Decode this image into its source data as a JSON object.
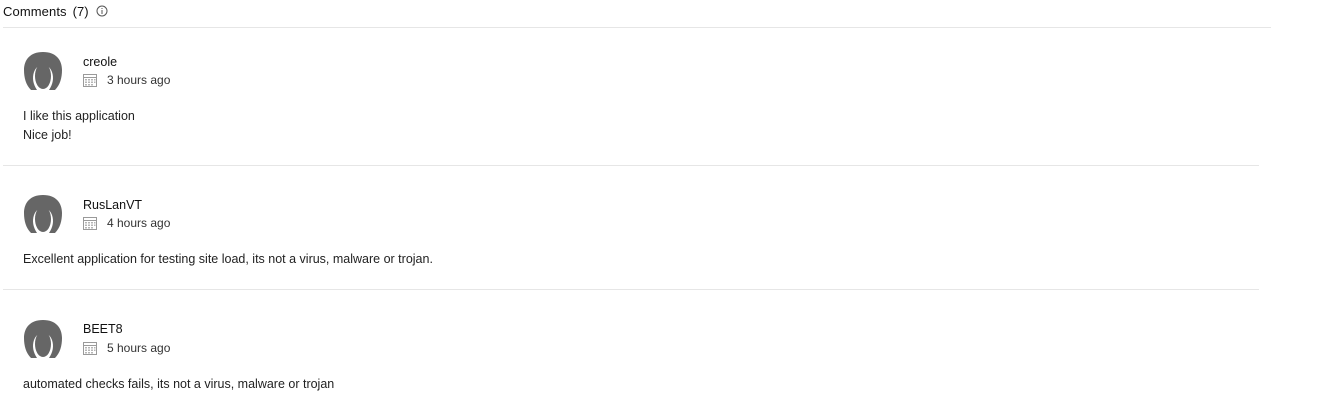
{
  "header": {
    "title": "Comments",
    "count": "(7)",
    "info_icon": "info-circle-icon"
  },
  "comments": [
    {
      "author": "creole",
      "time": "3 hours ago",
      "lines": [
        "I like this application",
        "Nice job!"
      ]
    },
    {
      "author": "RusLanVT",
      "time": "4 hours ago",
      "lines": [
        "Excellent application for testing site load, its not a virus, malware or trojan."
      ]
    },
    {
      "author": "BEET8",
      "time": "5 hours ago",
      "lines": [
        "automated checks fails, its not a virus, malware or trojan"
      ]
    }
  ],
  "colors": {
    "avatar": "#666666",
    "divider": "#e6e6e6",
    "icon": "#9a9a9a"
  },
  "icons": {
    "avatar": "user-avatar-icon",
    "date": "calendar-icon"
  }
}
